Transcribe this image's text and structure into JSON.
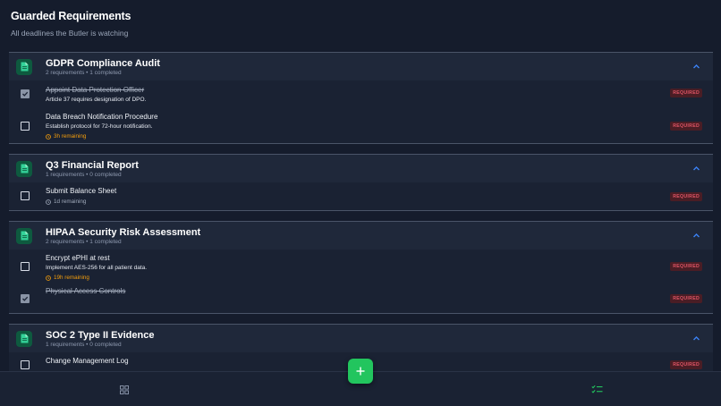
{
  "header": {
    "title": "Guarded Requirements",
    "subtitle": "All deadlines the Butler is watching"
  },
  "groups": [
    {
      "title": "GDPR Compliance Audit",
      "meta": "2 requirements • 1 completed",
      "requirements": [
        {
          "title": "Appoint Data Protection Officer",
          "desc": "Article 37 requires designation of DPO.",
          "done": true,
          "badge": "REQUIRED"
        },
        {
          "title": "Data Breach Notification Procedure",
          "desc": "Establish protocol for 72-hour notification.",
          "due": "3h remaining",
          "done": false,
          "badge": "REQUIRED"
        }
      ]
    },
    {
      "title": "Q3 Financial Report",
      "meta": "1 requirements • 0 completed",
      "requirements": [
        {
          "title": "Submit Balance Sheet",
          "due": "1d remaining",
          "done": false,
          "badge": "REQUIRED"
        }
      ]
    },
    {
      "title": "HIPAA Security Risk Assessment",
      "meta": "2 requirements • 1 completed",
      "requirements": [
        {
          "title": "Encrypt ePHI at rest",
          "desc": "Implement AES-256 for all patient data.",
          "due": "19h remaining",
          "done": false,
          "badge": "REQUIRED"
        },
        {
          "title": "Physical Access Controls",
          "done": true,
          "badge": "REQUIRED"
        }
      ]
    },
    {
      "title": "SOC 2 Type II Evidence",
      "meta": "1 requirements • 0 completed",
      "requirements": [
        {
          "title": "Change Management Log",
          "done": false,
          "badge": "REQUIRED"
        }
      ]
    }
  ],
  "icons": {
    "group": "document-icon",
    "collapse": "chevron-up-icon",
    "due": "clock-icon",
    "fab": "plus-icon",
    "nav_left": "grid-icon",
    "nav_right": "checklist-icon"
  },
  "colors": {
    "accent": "#22c55e",
    "warning": "#f59e0b",
    "badge_text": "#e05565",
    "badge_bg": "#4a1d25",
    "chevron": "#3b82f6",
    "background": "#151c2c"
  }
}
